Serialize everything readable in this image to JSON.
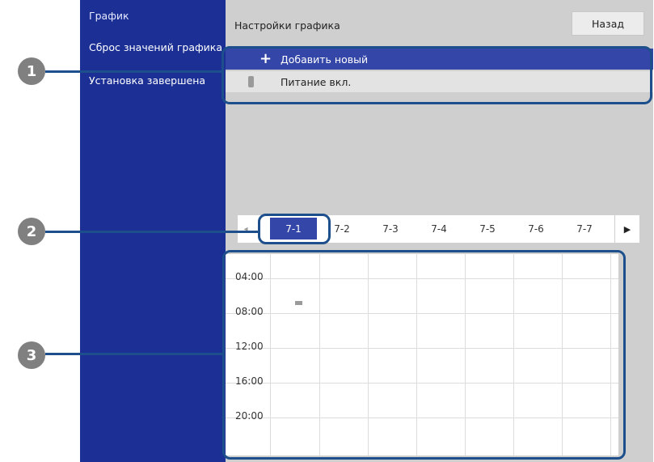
{
  "sidebar": {
    "items": [
      {
        "label": "График"
      },
      {
        "label": "Сброс значений графика"
      },
      {
        "label": "Установка завершена"
      }
    ]
  },
  "header": {
    "title": "Настройки графика",
    "back_label": "Назад"
  },
  "list": {
    "add_new_label": "Добавить новый",
    "power_on_label": "Питание вкл."
  },
  "tabs": {
    "items": [
      "7-1",
      "7-2",
      "7-3",
      "7-4",
      "7-5",
      "7-6",
      "7-7"
    ],
    "active": "7-1"
  },
  "timeline": {
    "times": [
      "04:00",
      "08:00",
      "12:00",
      "16:00",
      "20:00"
    ]
  },
  "callouts": [
    "1",
    "2",
    "3"
  ],
  "colors": {
    "sidebar_bg": "#1c2f95",
    "accent": "#3446a8",
    "callout": "#1d4f8c"
  }
}
